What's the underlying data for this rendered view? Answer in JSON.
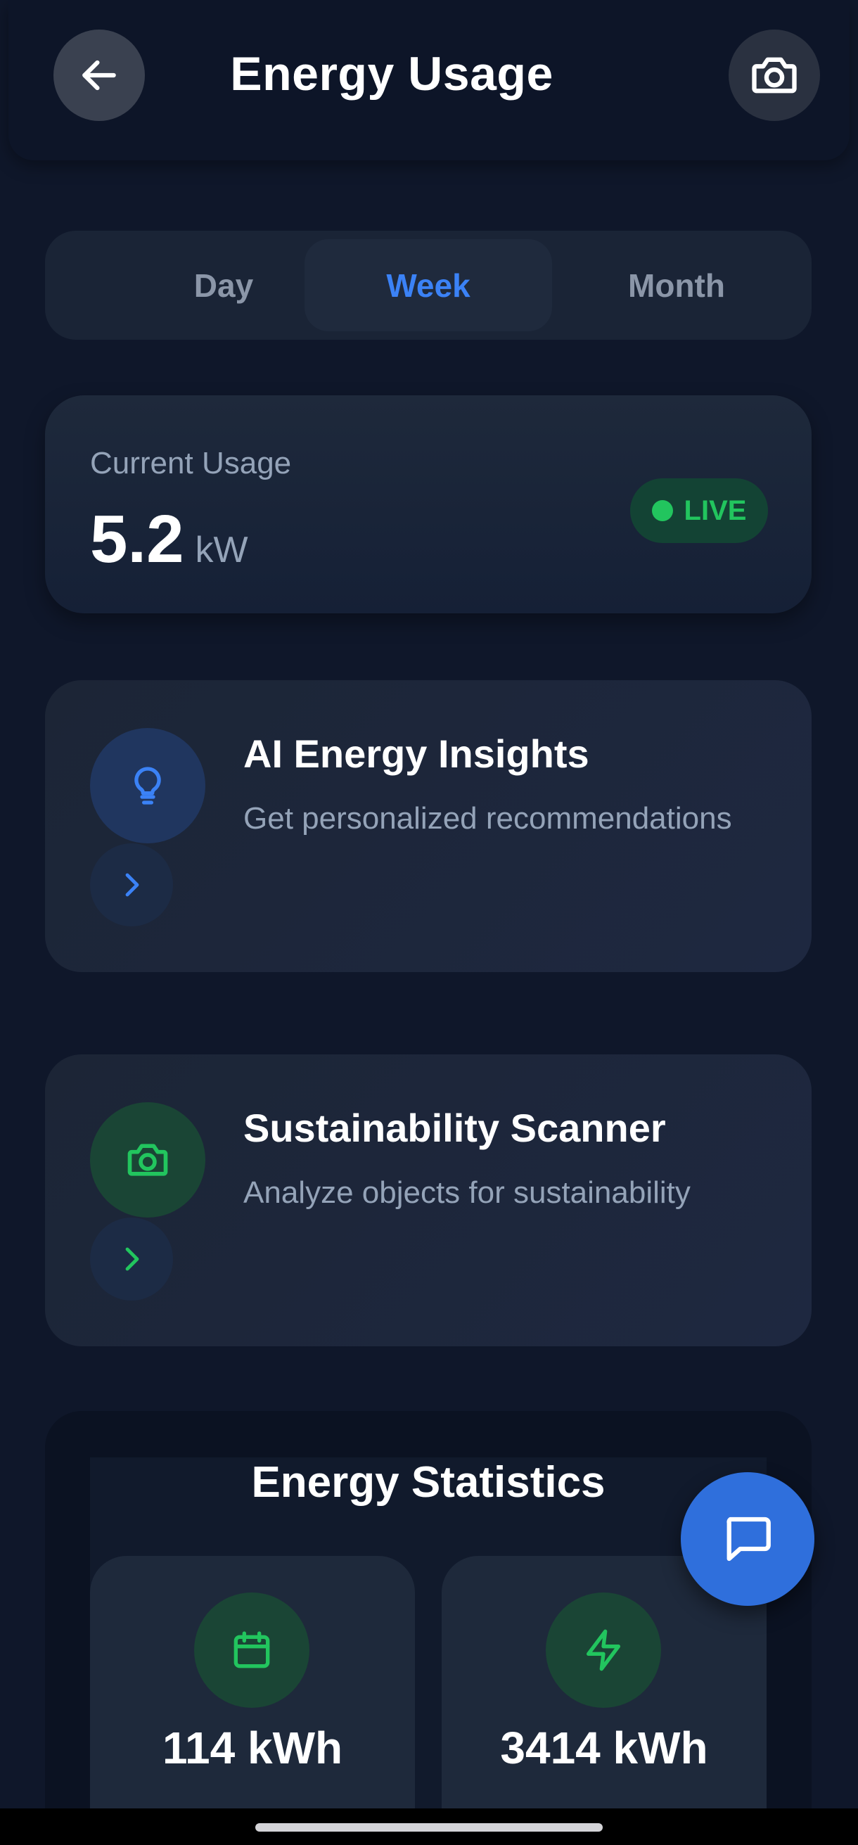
{
  "header": {
    "title": "Energy Usage",
    "back_icon": "arrow-left-icon",
    "camera_icon": "camera-icon"
  },
  "segments": {
    "items": [
      {
        "label": "Day",
        "active": false
      },
      {
        "label": "Week",
        "active": true
      },
      {
        "label": "Month",
        "active": false
      }
    ]
  },
  "current_usage": {
    "label": "Current Usage",
    "value": "5.2",
    "unit": "kW",
    "badge": "LIVE"
  },
  "features": [
    {
      "title": "AI Energy Insights",
      "subtitle": "Get personalized recommendations",
      "icon": "lightbulb-icon"
    },
    {
      "title": "Sustainability Scanner",
      "subtitle": "Analyze objects for sustainability",
      "icon": "camera-icon"
    }
  ],
  "stats": {
    "title": "Energy Statistics",
    "items": [
      {
        "value": "114 kWh",
        "icon": "calendar-icon"
      },
      {
        "value": "3414 kWh",
        "icon": "lightning-icon"
      }
    ]
  },
  "chat_icon": "chat-bubble-icon",
  "colors": {
    "background": "#0f172a",
    "accent_blue": "#3b82f6",
    "accent_green": "#22c55e",
    "card": "#1e293b",
    "muted_text": "#94a3b8"
  }
}
